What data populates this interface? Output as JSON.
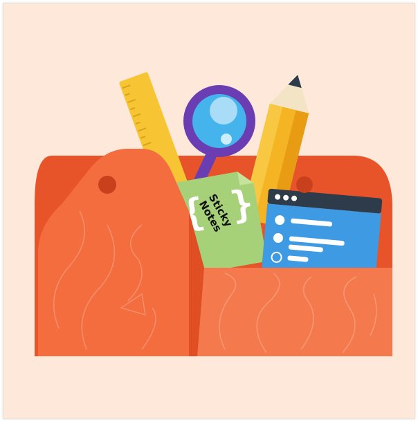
{
  "colors": {
    "background": "#fde8da",
    "box_dark": "#e8542a",
    "box_light": "#f36d3f",
    "box_front": "#f47a4d",
    "ruler": "#f7c534",
    "magnifier_ring": "#6a3db2",
    "magnifier_lens": "#45b3ec",
    "pencil_body": "#f5b423",
    "pencil_tip": "#f3e4c6",
    "pencil_lead": "#2e3b4a",
    "sticky_note": "#a6d178",
    "sticky_note_fold": "#c6e39c",
    "window_frame": "#2e3b4a",
    "window_body": "#3d9ae3",
    "window_line": "#ffffff"
  },
  "icons": {
    "toolbox": "toolbox-icon",
    "ruler": "ruler-icon",
    "magnifier": "magnifying-glass-icon",
    "pencil": "pencil-icon",
    "sticky_note": "sticky-note-icon",
    "browser_window": "browser-window-icon"
  },
  "sticky_note": {
    "line1": "Sticky",
    "line2": "Notes"
  }
}
